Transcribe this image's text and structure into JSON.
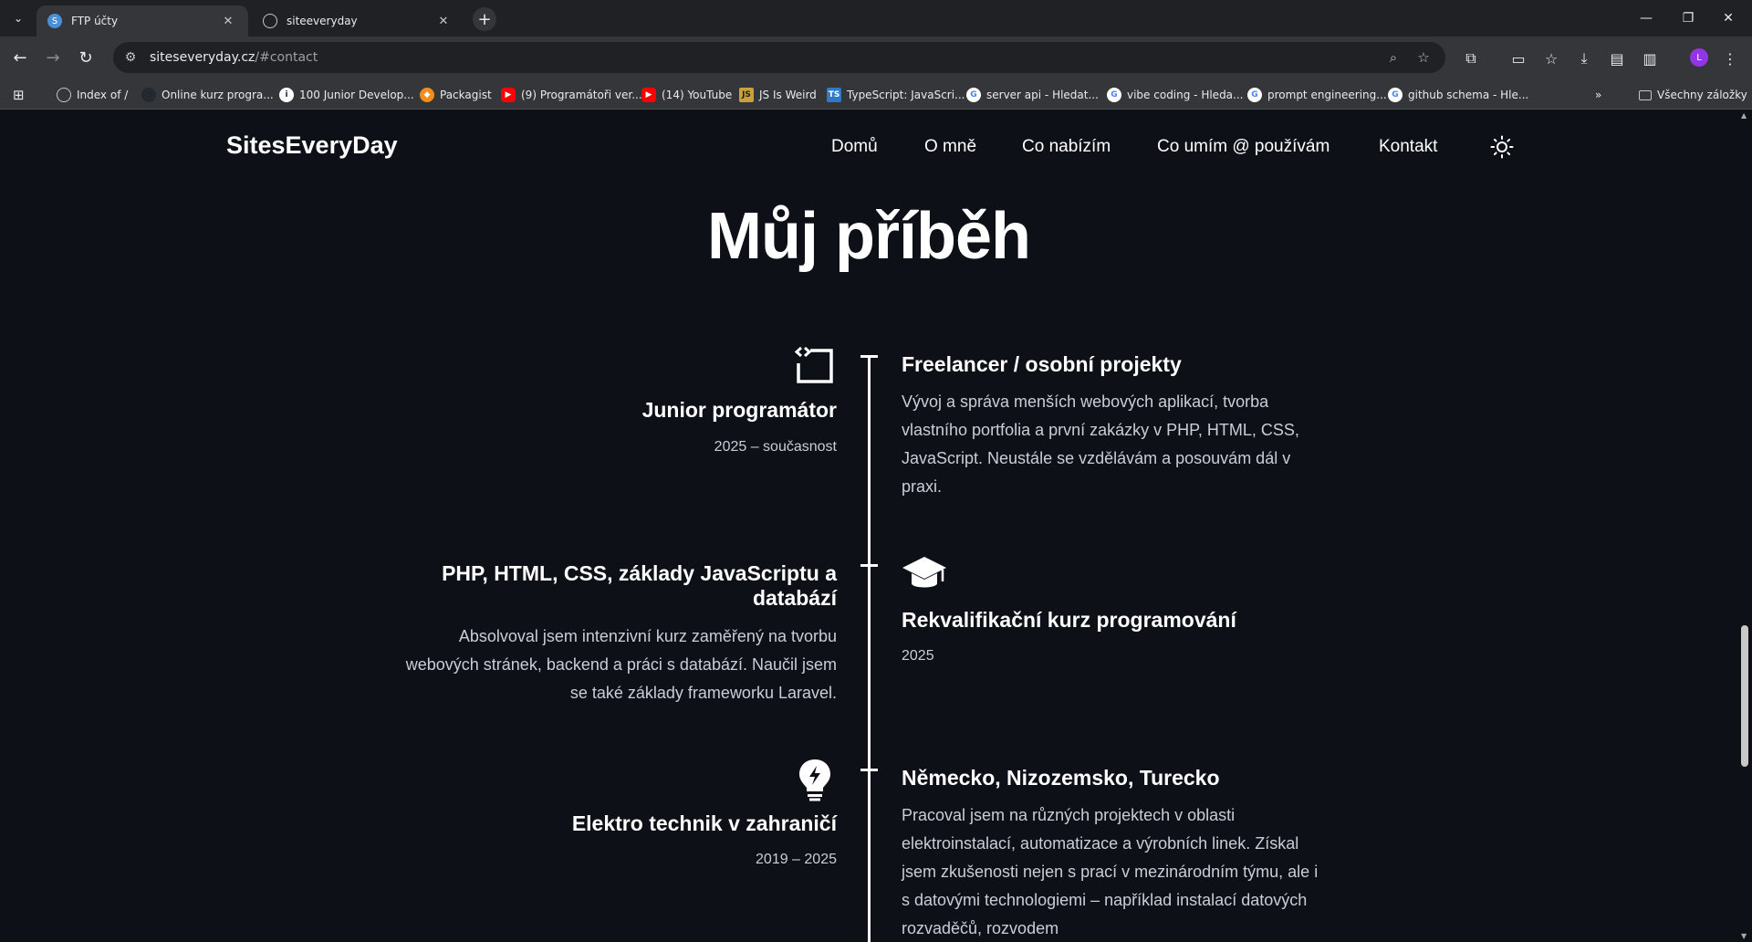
{
  "browser": {
    "tabs": [
      {
        "title": "FTP účty",
        "active": true
      },
      {
        "title": "siteeveryday",
        "active": false
      }
    ],
    "url_host": "siteseveryday.cz",
    "url_path": "/#contact",
    "profile_initial": "L",
    "bookmarks": [
      {
        "label": "Index of /",
        "icon": "globe-icon"
      },
      {
        "label": "Online kurz progra...",
        "icon": "github-icon"
      },
      {
        "label": "100 Junior Develop...",
        "icon": "info-icon"
      },
      {
        "label": "Packagist",
        "icon": "packagist-icon"
      },
      {
        "label": "(9) Programátoři ver...",
        "icon": "youtube-icon"
      },
      {
        "label": "(14) YouTube",
        "icon": "youtube-icon"
      },
      {
        "label": "JS Is Weird",
        "icon": "js-icon"
      },
      {
        "label": "TypeScript: JavaScri...",
        "icon": "ts-icon"
      },
      {
        "label": "server api - Hledat...",
        "icon": "google-icon"
      },
      {
        "label": "vibe coding - Hleda...",
        "icon": "google-icon"
      },
      {
        "label": "prompt engineering...",
        "icon": "google-icon"
      },
      {
        "label": "github schema - Hle...",
        "icon": "google-icon"
      }
    ],
    "all_bookmarks_label": "Všechny záložky"
  },
  "site": {
    "logo": "SitesEveryDay",
    "nav": [
      "Domů",
      "O mně",
      "Co nabízím",
      "Co umím @ používám",
      "Kontakt"
    ],
    "theme_icon": "sun-icon"
  },
  "story": {
    "heading": "Můj příběh",
    "entries": [
      {
        "icon": "code-window-icon",
        "title": "Junior programátor",
        "date": "2025 – současnost",
        "detail_title": "Freelancer / osobní projekty",
        "description": "Vývoj a správa menších webových aplikací, tvorba vlastního portfolia a první zakázky v PHP, HTML, CSS, JavaScript. Neustále se vzdělávám a posouvám dál v praxi."
      },
      {
        "icon": "graduation-cap-icon",
        "title": "Rekvalifikační kurz programování",
        "date": "2025",
        "detail_title": "PHP, HTML, CSS, základy JavaScriptu a databází",
        "description": "Absolvoval jsem intenzivní kurz zaměřený na tvorbu webových stránek, backend a práci s databází. Naučil jsem se také základy frameworku Laravel."
      },
      {
        "icon": "lightbulb-icon",
        "title": "Elektro technik v zahraničí",
        "date": "2019 – 2025",
        "detail_title": "Německo, Nizozemsko, Turecko",
        "description": "Pracoval jsem na různých projektech v oblasti elektroinstalací, automatizace a výrobních linek. Získal jsem zkušenosti nejen s prací v mezinárodním týmu, ale i s datovými technologiemi – například instalací datových rozvaděčů, rozvodem"
      }
    ]
  }
}
